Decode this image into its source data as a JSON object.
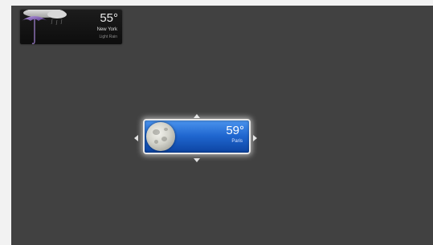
{
  "top_widget": {
    "temperature": "55°",
    "location": "New York",
    "condition": "Light Rain",
    "icon": "umbrella-icon"
  },
  "center_widget": {
    "temperature": "59°",
    "location": "Paris",
    "icon": "moon-icon"
  },
  "resize_handles": [
    "arrow-up-icon",
    "arrow-down-icon",
    "arrow-left-icon",
    "arrow-right-icon"
  ],
  "colors": {
    "screen_background": "#414141",
    "widget_blue": "#1f66cf",
    "widget_border": "#e8e8e8",
    "top_widget_background": "#111111"
  }
}
